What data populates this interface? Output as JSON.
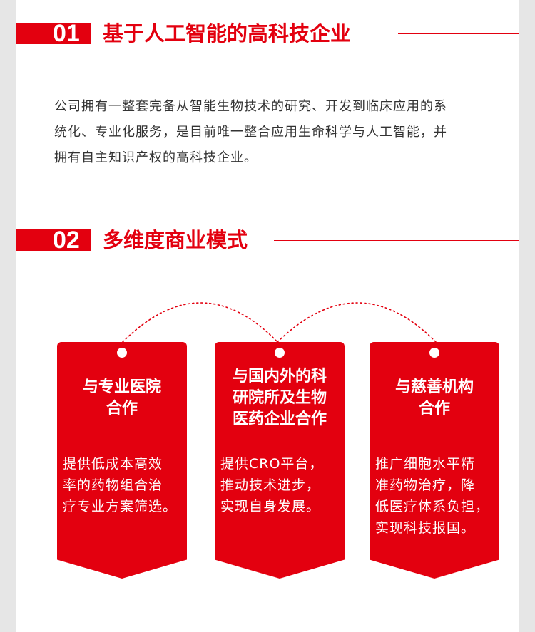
{
  "section1": {
    "number": "01",
    "title": "基于人工智能的高科技企业",
    "paragraph_lines": [
      "公司拥有一整套完备从智能生物技术的研究、开发到临床应用的系",
      "统化、专业化服务，是目前唯一整合应用生命科学与人工智能，并",
      "拥有自主知识产权的高科技企业。"
    ]
  },
  "section2": {
    "number": "02",
    "title": "多维度商业模式",
    "cards": [
      {
        "title_lines": [
          "与专业医院",
          "合作"
        ],
        "body_lines": [
          "提供低成本高效",
          "率的药物组合治",
          "疗专业方案筛选。"
        ]
      },
      {
        "title_lines": [
          "与国内外的科",
          "研院所及生物",
          "医药企业合作"
        ],
        "body_lines": [
          "提供CRO平台，",
          "推动技术进步，",
          "实现自身发展。"
        ]
      },
      {
        "title_lines": [
          "与慈善机构",
          "合作"
        ],
        "body_lines": [
          "推广细胞水平精",
          "准药物治疗，降",
          "低医疗体系负担，",
          "实现科技报国。"
        ]
      }
    ]
  },
  "colors": {
    "brand_red": "#e3000f",
    "text_gray": "#333333",
    "background": "#ffffff"
  }
}
